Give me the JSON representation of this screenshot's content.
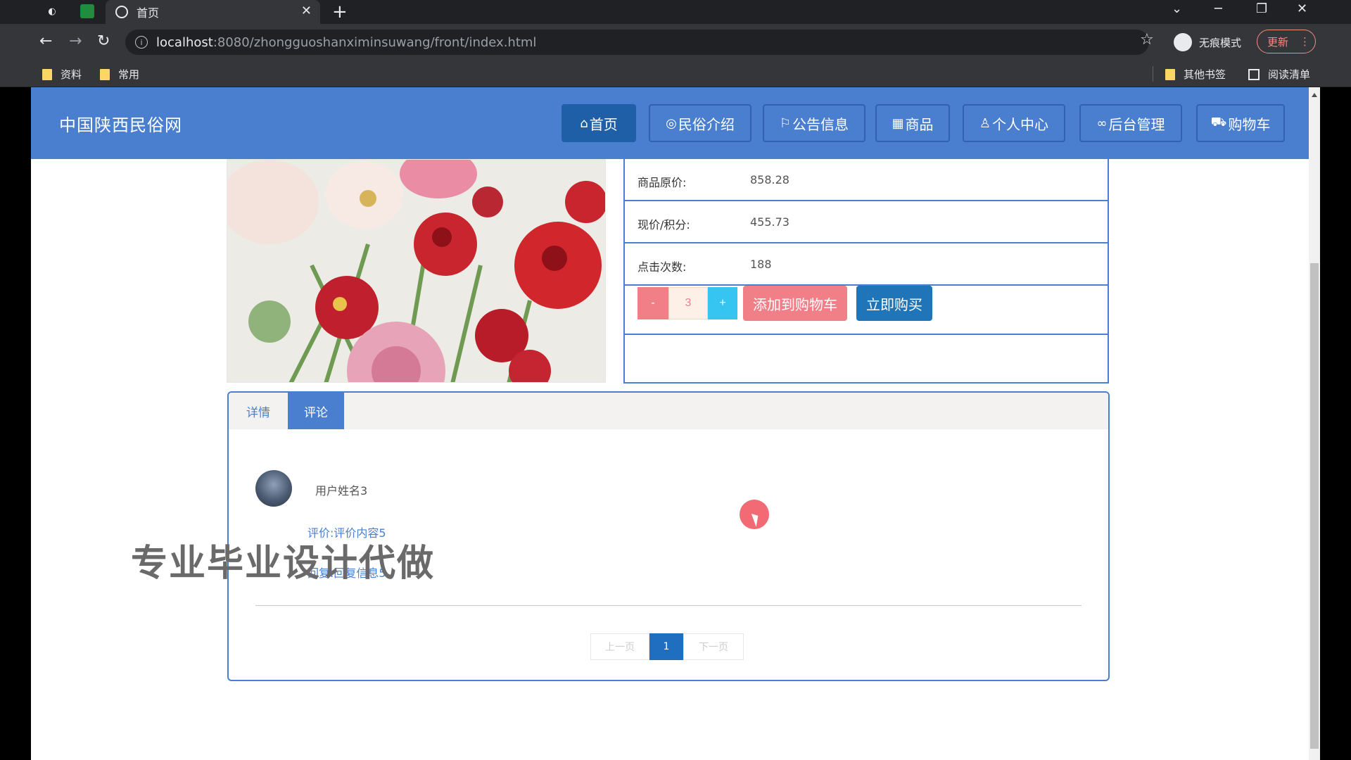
{
  "browser": {
    "tab_title": "首页",
    "url_host": "localhost",
    "url_path": ":8080/zhongguoshanximinsuwang/front/index.html",
    "incognito_label": "无痕模式",
    "update_label": "更新",
    "bookmarks": [
      "资料",
      "常用"
    ],
    "other_bookmarks": "其他书签",
    "reading_list": "阅读清单"
  },
  "site": {
    "title": "中国陕西民俗网",
    "nav": [
      {
        "icon": "home-icon",
        "label": "首页"
      },
      {
        "icon": "palette-icon",
        "label": "民俗介绍"
      },
      {
        "icon": "flag-icon",
        "label": "公告信息"
      },
      {
        "icon": "calendar-icon",
        "label": "商品"
      },
      {
        "icon": "user-icon",
        "label": "个人中心"
      },
      {
        "icon": "link-icon",
        "label": "后台管理"
      },
      {
        "icon": "cart-icon",
        "label": "购物车"
      }
    ]
  },
  "product": {
    "rows": [
      {
        "label": "商品原价:",
        "value": "858.28"
      },
      {
        "label": "现价/积分:",
        "value": "455.73"
      },
      {
        "label": "点击次数:",
        "value": "188"
      }
    ],
    "qty_minus": "-",
    "quantity": "3",
    "qty_plus": "+",
    "add_to_cart": "添加到购物车",
    "buy_now": "立即购买"
  },
  "tabs": {
    "detail": "详情",
    "comment": "评论"
  },
  "comment": {
    "user": "用户姓名3",
    "content": "评价:评价内容5",
    "reply": "回复:回复信息5"
  },
  "pager": {
    "prev": "上一页",
    "current": "1",
    "next": "下一页"
  },
  "watermark": "专业毕业设计代做",
  "colors": {
    "header": "#4a7fd0",
    "active_nav": "#1f5fa8",
    "add_cart": "#f07f88",
    "buy_now": "#1f75b8"
  }
}
